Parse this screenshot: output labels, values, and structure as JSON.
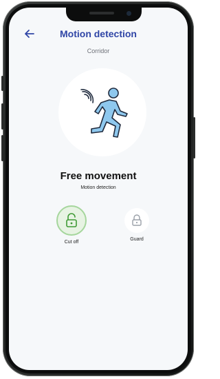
{
  "header": {
    "title": "Motion detection",
    "subtitle": "Corridor"
  },
  "status": {
    "title": "Free movement",
    "subtitle": "Motion detection"
  },
  "actions": [
    {
      "label": "Cut off",
      "icon": "lock-open-icon",
      "active": true
    },
    {
      "label": "Guard",
      "icon": "lock-icon",
      "active": false
    }
  ],
  "colors": {
    "accent": "#2f45a6",
    "active_green": "#a5d69c",
    "hero_blue": "#8ec8ee"
  }
}
